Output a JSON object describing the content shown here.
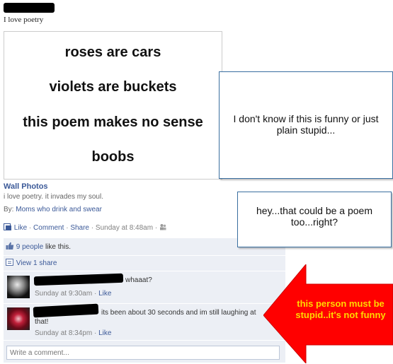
{
  "post": {
    "text": "I love poetry"
  },
  "photo": {
    "lines": [
      "roses are cars",
      "violets are buckets",
      "this poem makes no sense",
      "boobs"
    ]
  },
  "meta": {
    "album": "Wall Photos",
    "caption": "i love poetry. it invades my soul.",
    "by_prefix": "By:",
    "by_name": "Moms who drink and swear",
    "like": "Like",
    "comment": "Comment",
    "share": "Share",
    "timestamp": "Sunday at 8:48am",
    "sep": "·"
  },
  "feedback": {
    "likes_count": "9 people",
    "likes_suffix": "like this.",
    "view_shares": "View 1 share"
  },
  "comments": [
    {
      "text": "whaaat?",
      "time": "Sunday at 9:30am",
      "like": "Like"
    },
    {
      "text_line1": "its been about 30 seconds and im still laughing at",
      "text_line2": "that!",
      "time": "Sunday at 8:34pm",
      "like": "Like"
    }
  ],
  "composer": {
    "placeholder": "Write a comment..."
  },
  "annotations": {
    "note1": "I don't know if this is funny or just plain stupid...",
    "note2": "hey...that could be a poem too...right?",
    "arrow_text": "this person must be stupid..it's not funny"
  },
  "colors": {
    "link": "#3b5998",
    "comment_bg": "#eceff5",
    "arrow_red": "#ff0000",
    "arrow_text": "#ffd800"
  }
}
